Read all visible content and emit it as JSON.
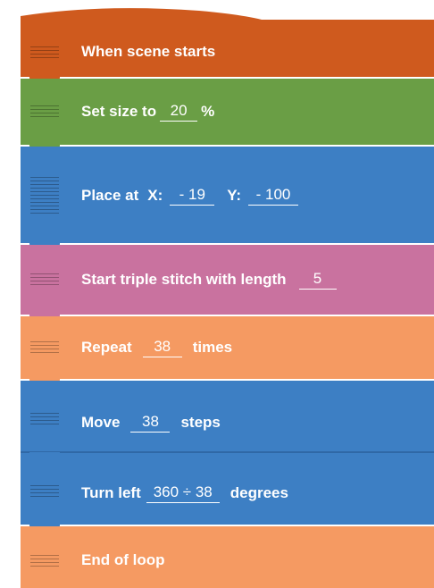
{
  "colors": {
    "event": "#cf5a1e",
    "looks": "#6a9e45",
    "motion": "#3d7fc4",
    "pen": "#c9729f",
    "control": "#f59a62"
  },
  "blocks": [
    {
      "id": "when-scene-starts",
      "label": "When scene starts"
    },
    {
      "id": "set-size",
      "label": "Set size to",
      "value": "20",
      "suffix": "%"
    },
    {
      "id": "place-at",
      "label": "Place at",
      "x_label": "X:",
      "x_value": "- 19",
      "y_label": "Y:",
      "y_value": "- 100"
    },
    {
      "id": "start-triple-stitch",
      "label": "Start triple stitch with length",
      "value": "5"
    },
    {
      "id": "repeat",
      "label": "Repeat",
      "value": "38",
      "suffix": "times"
    },
    {
      "id": "move",
      "label": "Move",
      "value": "38",
      "suffix": "steps"
    },
    {
      "id": "turn-left",
      "label": "Turn left",
      "value": "360 ÷ 38",
      "suffix": "degrees"
    },
    {
      "id": "end-of-loop",
      "label": "End of loop"
    }
  ]
}
